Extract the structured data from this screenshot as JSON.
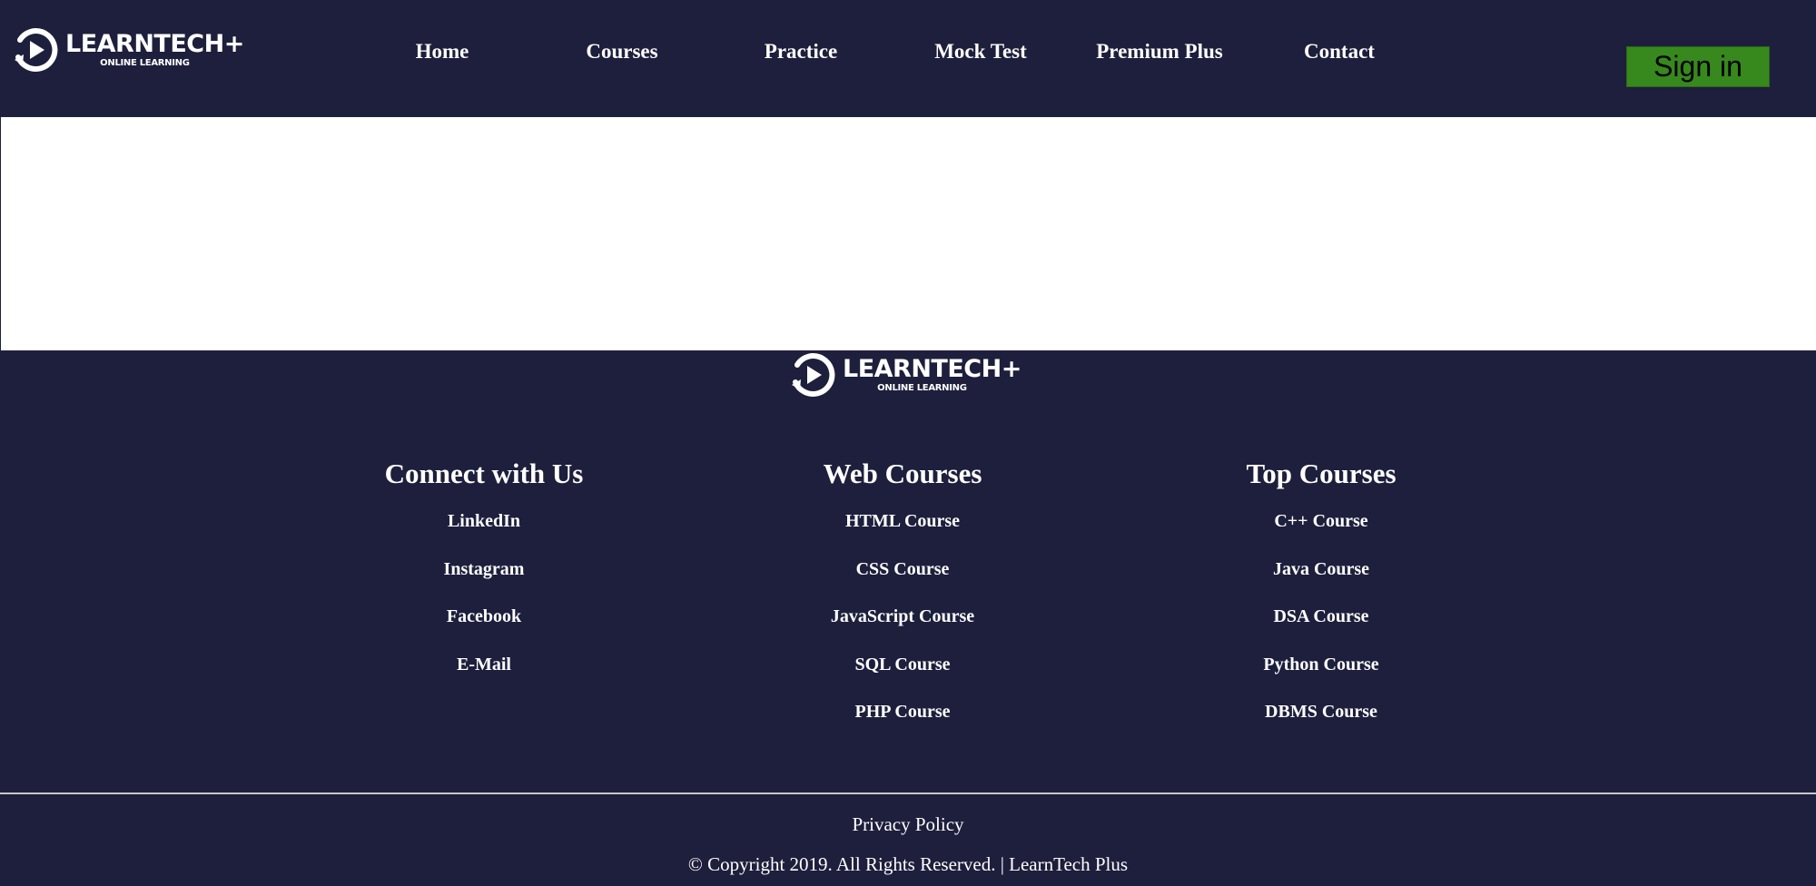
{
  "brand": {
    "name": "LEARNTECH+",
    "tagline": "ONLINE LEARNING",
    "logo_icon": "play-circle-icon"
  },
  "nav": {
    "items": [
      {
        "label": "Home"
      },
      {
        "label": "Courses"
      },
      {
        "label": "Practice"
      },
      {
        "label": "Mock Test"
      },
      {
        "label": "Premium Plus"
      },
      {
        "label": "Contact"
      }
    ]
  },
  "signin": {
    "label": "Sign in"
  },
  "footer": {
    "columns": [
      {
        "title": "Connect with Us",
        "links": [
          "LinkedIn",
          "Instagram",
          "Facebook",
          "E-Mail"
        ]
      },
      {
        "title": "Web Courses",
        "links": [
          "HTML Course",
          "CSS Course",
          "JavaScript Course",
          "SQL Course",
          "PHP Course"
        ]
      },
      {
        "title": "Top Courses",
        "links": [
          "C++ Course",
          "Java Course",
          "DSA Course",
          "Python Course",
          "DBMS Course"
        ]
      }
    ],
    "privacy": "Privacy Policy",
    "copyright": "© Copyright 2019. All Rights Reserved. | LearnTech Plus"
  },
  "colors": {
    "background": "#1d1f3c",
    "signin_button": "#37881d",
    "content_area": "#ffffff"
  }
}
